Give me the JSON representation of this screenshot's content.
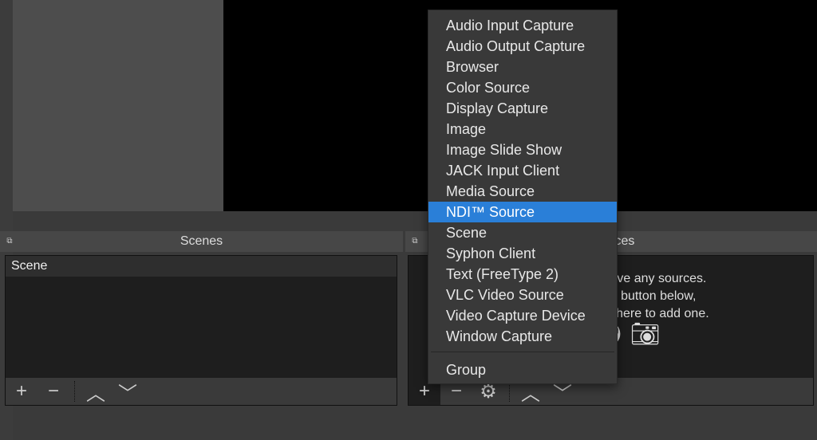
{
  "docks": {
    "scenes": {
      "title": "Scenes",
      "items": [
        "Scene"
      ]
    },
    "sources": {
      "title": "Sources",
      "empty_lines": [
        "You don't have any sources.",
        "Click the + button below,",
        "or right click here to add one."
      ]
    }
  },
  "toolbar_icons": [
    "plus-icon",
    "minus-icon",
    "gear-icon",
    "chevron-up-icon",
    "chevron-down-icon"
  ],
  "add_source_menu": {
    "items": [
      "Audio Input Capture",
      "Audio Output Capture",
      "Browser",
      "Color Source",
      "Display Capture",
      "Image",
      "Image Slide Show",
      "JACK Input Client",
      "Media Source",
      "NDI™ Source",
      "Scene",
      "Syphon Client",
      "Text (FreeType 2)",
      "VLC Video Source",
      "Video Capture Device",
      "Window Capture"
    ],
    "group_item": "Group",
    "highlighted": "NDI™ Source"
  },
  "colors": {
    "highlight": "#2a7fd8",
    "background": "#3a3a3a",
    "preview": "#000000"
  }
}
